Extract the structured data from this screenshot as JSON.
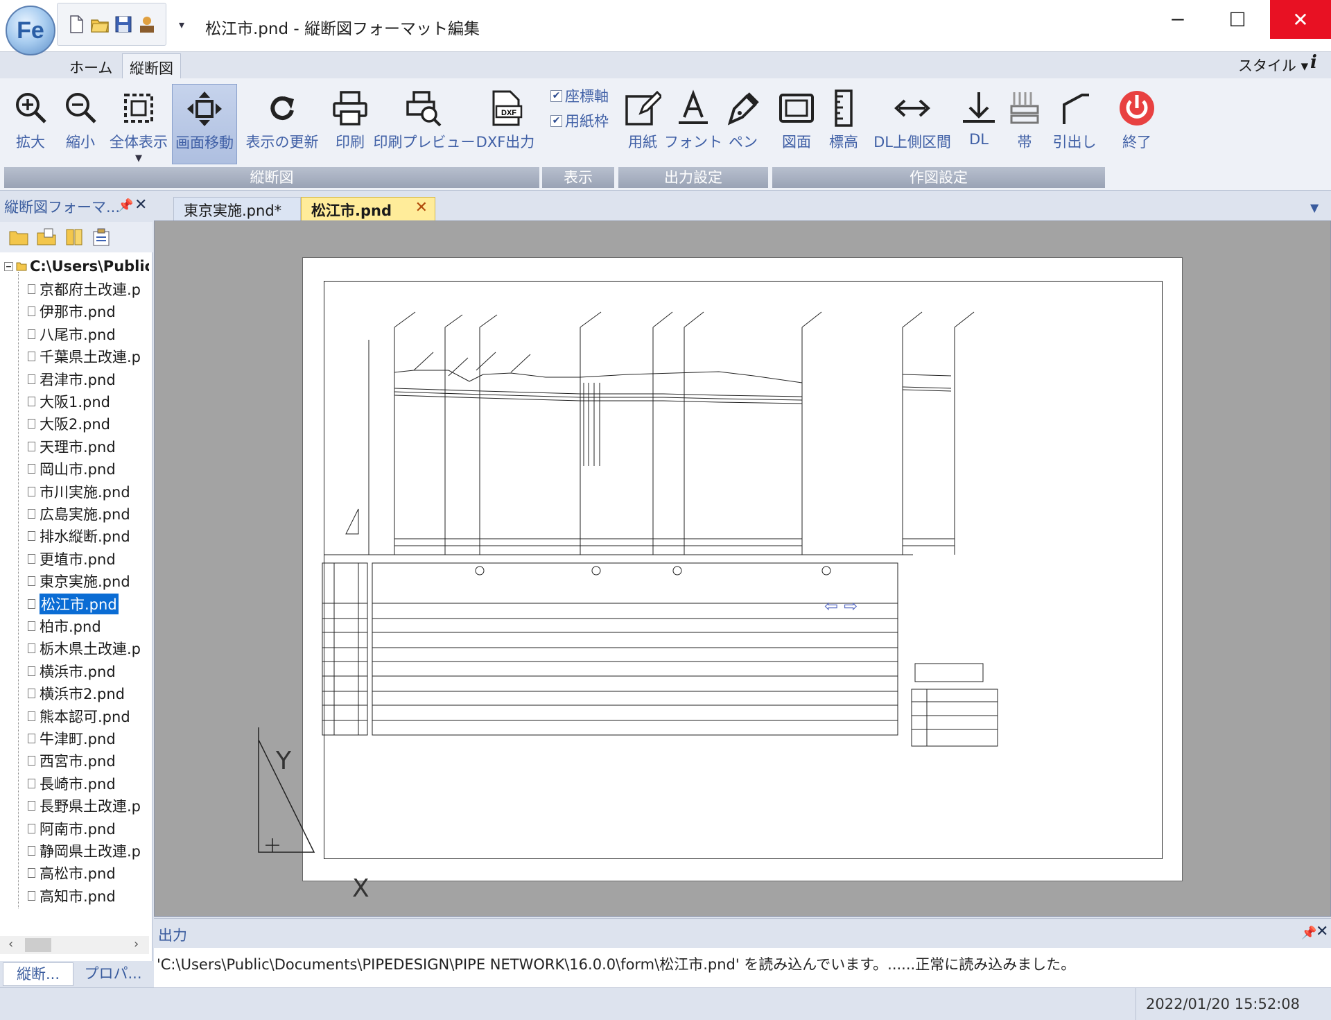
{
  "window": {
    "title": "松江市.pnd - 縦断図フォーマット編集",
    "app_logo": "Fe",
    "minimize": "─",
    "maximize": "☐",
    "close": "✕"
  },
  "ribbon_tabs": {
    "home": "ホーム",
    "profile": "縦断図",
    "style": "スタイル ▾",
    "info": "i"
  },
  "ribbon": {
    "groups": {
      "profile": "縦断図",
      "display": "表示",
      "output_settings": "出力設定",
      "drawing_settings": "作図設定"
    },
    "buttons": {
      "zoom_in": "拡大",
      "zoom_out": "縮小",
      "fit_all": "全体表示",
      "pan": "画面移動",
      "refresh": "表示の更新",
      "print": "印刷",
      "print_preview": "印刷プレビュー",
      "dxf_export": "DXF出力",
      "paper": "用紙",
      "font": "フォント",
      "pen": "ペン",
      "drawing": "図面",
      "elevation": "標高",
      "dl_upper": "DL上側区間",
      "dl": "DL",
      "band": "帯",
      "leader": "引出し",
      "exit": "終了"
    },
    "checkboxes": {
      "coord_axis": {
        "label": "座標軸",
        "checked": true
      },
      "paper_frame": {
        "label": "用紙枠",
        "checked": true
      }
    },
    "active_button": "pan",
    "exit_color": "#e84141"
  },
  "left_panel": {
    "title": "縦断図フォーマ...",
    "root": "C:\\Users\\Public\\",
    "files": [
      "京都府土改連.p",
      "伊那市.pnd",
      "八尾市.pnd",
      "千葉県土改連.p",
      "君津市.pnd",
      "大阪1.pnd",
      "大阪2.pnd",
      "天理市.pnd",
      "岡山市.pnd",
      "市川実施.pnd",
      "広島実施.pnd",
      "排水縦断.pnd",
      "更埴市.pnd",
      "東京実施.pnd",
      "松江市.pnd",
      "柏市.pnd",
      "栃木県土改連.p",
      "横浜市.pnd",
      "横浜市2.pnd",
      "熊本認可.pnd",
      "牛津町.pnd",
      "西宮市.pnd",
      "長崎市.pnd",
      "長野県土改連.p",
      "阿南市.pnd",
      "静岡県土改連.p",
      "高松市.pnd",
      "高知市.pnd"
    ],
    "selected": "松江市.pnd",
    "bottom_tabs": [
      "縦断...",
      "プロパ..."
    ]
  },
  "doc_tabs": {
    "tab1": "東京実施.pnd*",
    "tab2": "松江市.pnd",
    "active": "松江市.pnd",
    "active_color": "#ffec9a"
  },
  "canvas": {
    "axis_y": "Y",
    "axis_x": "X",
    "nav_left": "⇦",
    "nav_right": "⇨"
  },
  "output": {
    "title": "出力",
    "message": "'C:\\Users\\Public\\Documents\\PIPEDESIGN\\PIPE NETWORK\\16.0.0\\form\\松江市.pnd' を読み込んでいます。......正常に読み込みました。"
  },
  "status": {
    "datetime": "2022/01/20 15:52:08"
  }
}
